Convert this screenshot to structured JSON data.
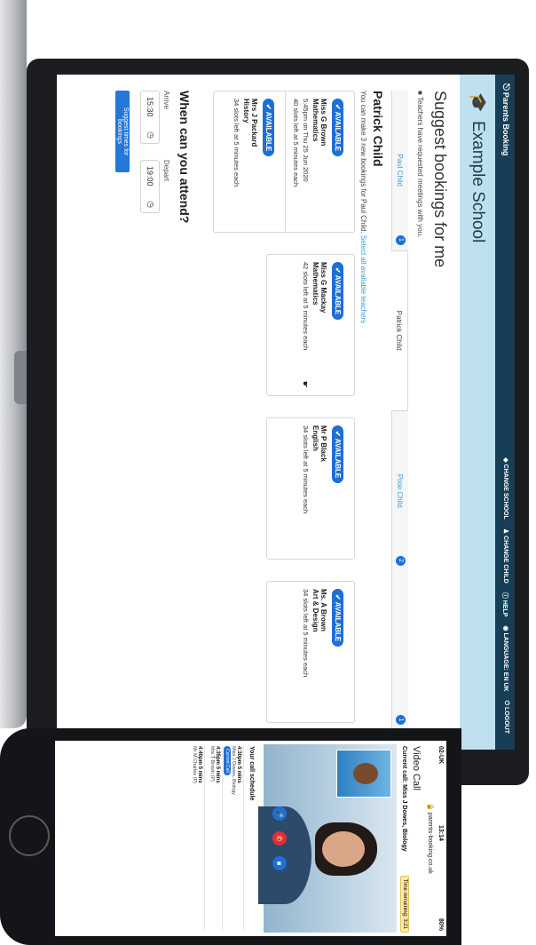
{
  "nav": {
    "brand": "Parents Booking",
    "links": [
      "CHANGE SCHOOL",
      "CHANGE CHILD",
      "HELP",
      "LANGUAGE: EN UK",
      "LOGOUT"
    ]
  },
  "school": {
    "name": "Example School"
  },
  "page": {
    "heading": "Suggest bookings for me",
    "notice": "Teachers have requested meetings with you.",
    "tabs": [
      {
        "label": "Paul Child",
        "badge": "1",
        "active": false
      },
      {
        "label": "Patrick Child",
        "badge": "",
        "active": true
      },
      {
        "label": "Pixie Child",
        "badge": "2",
        "active": false
      },
      {
        "label": "",
        "badge": "1",
        "active": false
      }
    ],
    "child_name": "Patrick Child",
    "make_info": "You can make 3 new bookings for Paul Child.",
    "make_link": "Select all available teachers",
    "available_label": "AVAILABLE",
    "teachers": [
      {
        "name": "Miss G Brown",
        "subject": "Mathematics",
        "line1": "5:45pm on Thu 25 Jun 2020",
        "line2": "40 slots left at 5 minutes each"
      },
      {
        "name": "Miss G Mackay",
        "subject": "Mathematics",
        "line1": "42 slots left at 5 minutes each",
        "line2": ""
      },
      {
        "name": "Mr P Black",
        "subject": "English",
        "line1": "34 slots left at 5 minutes each",
        "line2": ""
      },
      {
        "name": "Ms. A Brown",
        "subject": "Art & Design",
        "line1": "34 slots left at 5 minutes each",
        "line2": ""
      },
      {
        "name": "Mrs J Packard",
        "subject": "History",
        "line1": "34 slots left at 5 minutes each",
        "line2": ""
      }
    ],
    "when_title": "When can you attend?",
    "arrive_label": "Arrive",
    "depart_label": "Depart",
    "arrive_value": "15:30",
    "depart_value": "19:00",
    "suggest_button": "Suggest times for bookings"
  },
  "phone": {
    "carrier": "02-UK",
    "time": "13:14",
    "battery": "80%",
    "url": "parents-booking.co.uk",
    "title": "Video Call",
    "current_call": "Current call: Miss J Dowes, Biology",
    "time_remaining": "Time remaining: 3:21",
    "schedule_title": "Your call schedule",
    "schedule": [
      {
        "time": "4:30pm",
        "dur": "5 mins",
        "who": "Miss J Dowes, Biology",
        "status": "Current Call"
      },
      {
        "time": "4:35pm",
        "dur": "5 mins",
        "who": "Mrs T Brown (P)",
        "status": ""
      },
      {
        "time": "4:40pm",
        "dur": "5 mins",
        "who": "Mr M Charles (P)",
        "status": ""
      }
    ]
  },
  "colors": {
    "nav": "#173e57",
    "banner": "#bfe1ef",
    "badge": "#1f6fd4",
    "button": "#2378d8"
  }
}
